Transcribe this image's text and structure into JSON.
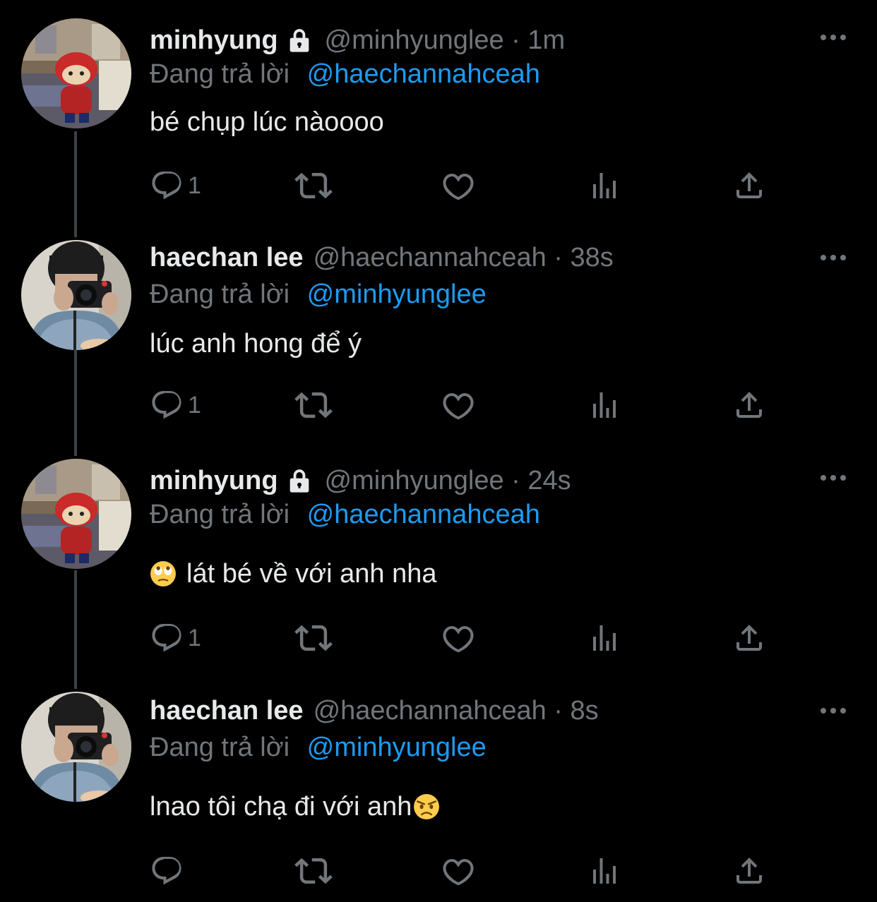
{
  "colors": {
    "background": "#000000",
    "text_primary": "#e7e9ea",
    "text_secondary": "#71767b",
    "link": "#1d9bf0",
    "thread_line": "#3e4144"
  },
  "reply_prefix": "Đang trả lời",
  "tweets": [
    {
      "display_name": "minhyung",
      "locked": true,
      "handle": "@minhyunglee",
      "time": "1m",
      "reply_to": "@haechannahceah",
      "emoji_before": "",
      "text": "bé chụp lúc nàoooo",
      "emoji_after": "",
      "reply_count": "1",
      "avatar": "spiderman-bear-plush-avatar"
    },
    {
      "display_name": "haechan lee",
      "locked": false,
      "handle": "@haechannahceah",
      "time": "38s",
      "reply_to": "@minhyunglee",
      "emoji_before": "",
      "text": "lúc anh hong để ý",
      "emoji_after": "",
      "reply_count": "1",
      "avatar": "person-with-camera-avatar"
    },
    {
      "display_name": "minhyung",
      "locked": true,
      "handle": "@minhyunglee",
      "time": "24s",
      "reply_to": "@haechannahceah",
      "emoji_before": "face-with-rolling-eyes-emoji",
      "text": "lát bé về với anh nha",
      "emoji_after": "",
      "reply_count": "1",
      "avatar": "spiderman-bear-plush-avatar"
    },
    {
      "display_name": "haechan lee",
      "locked": false,
      "handle": "@haechannahceah",
      "time": "8s",
      "reply_to": "@minhyunglee",
      "emoji_before": "",
      "text": "lnao tôi chạ đi với anh",
      "emoji_after": "angry-face-emoji",
      "reply_count": "",
      "avatar": "person-with-camera-avatar"
    }
  ]
}
